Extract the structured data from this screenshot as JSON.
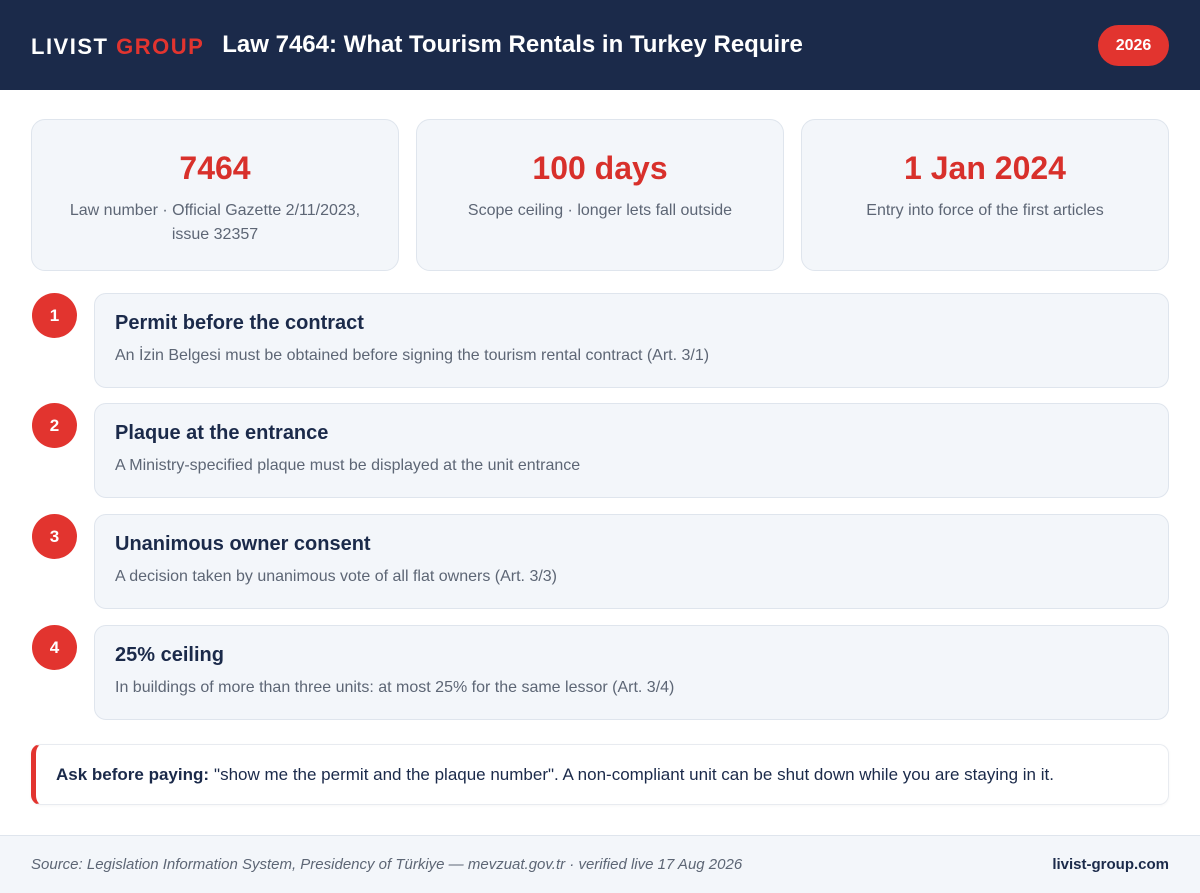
{
  "header": {
    "brand_primary": "LIVIST",
    "brand_accent": "GROUP",
    "title": "Law 7464: What Tourism Rentals in Turkey Require",
    "year_badge": "2026"
  },
  "stats": [
    {
      "value": "7464",
      "label": "Law number · Official Gazette 2/11/2023, issue 32357"
    },
    {
      "value": "100 days",
      "label": "Scope ceiling · longer lets fall outside"
    },
    {
      "value": "1 Jan 2024",
      "label": "Entry into force of the first articles"
    }
  ],
  "steps": [
    {
      "number": "1",
      "title": "Permit before the contract",
      "description": "An İzin Belgesi must be obtained before signing the tourism rental contract (Art. 3/1)"
    },
    {
      "number": "2",
      "title": "Plaque at the entrance",
      "description": "A Ministry-specified plaque must be displayed at the unit entrance"
    },
    {
      "number": "3",
      "title": "Unanimous owner consent",
      "description": "A decision taken by unanimous vote of all flat owners (Art. 3/3)"
    },
    {
      "number": "4",
      "title": "25% ceiling",
      "description": "In buildings of more than three units: at most 25% for the same lessor (Art. 3/4)"
    }
  ],
  "callout": {
    "lead": "Ask before paying:",
    "text": "\"show me the permit and the plaque number\". A non-compliant unit can be shut down while you are staying in it."
  },
  "footer": {
    "source": "Source: Legislation Information System, Presidency of Türkiye — mevzuat.gov.tr · verified live 17 Aug 2026",
    "site": "livist-group.com"
  },
  "colors": {
    "navy": "#1b2a4a",
    "accent_red": "#e2342f",
    "card_bg": "#f3f6fa",
    "muted_text": "#5d6675"
  }
}
